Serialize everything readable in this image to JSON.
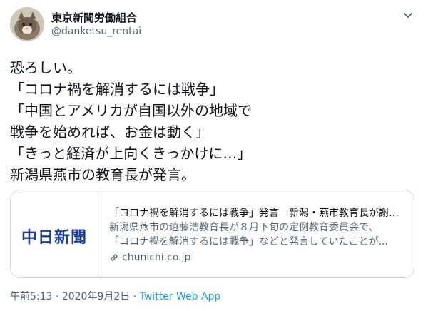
{
  "author": {
    "display_name": "東京新聞労働組合",
    "handle": "@danketsu_rentai"
  },
  "tweet": {
    "lines": [
      "恐ろしい。",
      "「コロナ禍を解消するには戦争」",
      "「中国とアメリカが自国以外の地域で",
      "戦争を始めれば、お金は動く」",
      "「きっと経済が上向くきっかけに…」",
      "新潟県燕市の教育長が発言。"
    ]
  },
  "card": {
    "logo_text": "中日新聞",
    "title": "「コロナ禍を解消するには戦争」発言　新潟・燕市教育長が謝罪...",
    "description_lines": [
      "新潟県燕市の遠藤浩教育長が８月下旬の定例教育委員会で、",
      "「コロナ禍を解消するには戦争」などと発言していたことが..."
    ],
    "domain": "chunichi.co.jp"
  },
  "meta": {
    "time": "午前5:13",
    "separator1": "·",
    "date": "2020年9月2日",
    "separator2": "·",
    "source": "Twitter Web App"
  },
  "colors": {
    "text": "#0f1419",
    "secondary": "#536471",
    "link": "#1d9bf0",
    "border": "#cfd9de",
    "logo": "#1c3f95"
  },
  "icons": {
    "more": "chevron-down-icon",
    "link": "link-icon"
  }
}
